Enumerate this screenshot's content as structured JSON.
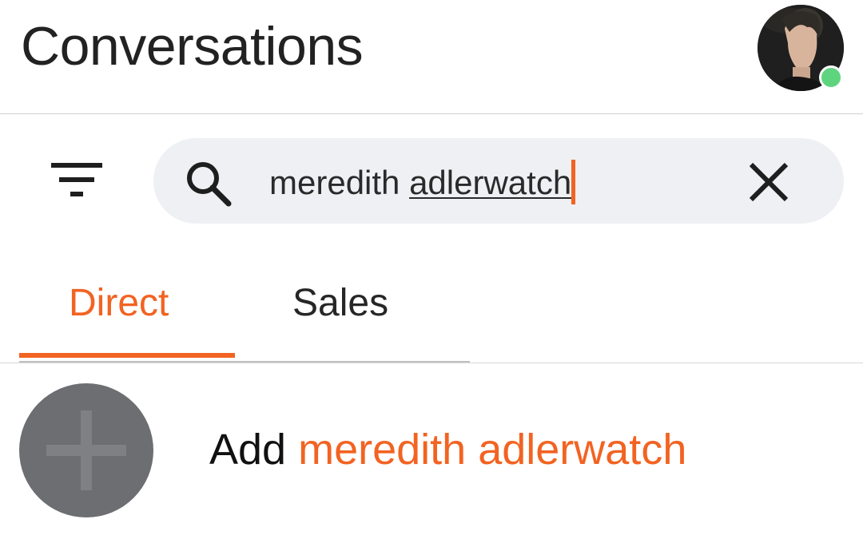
{
  "header": {
    "title": "Conversations",
    "avatar_icon": "profile-photo",
    "presence_status_color": "#5fd47f"
  },
  "search": {
    "filter_icon": "filter-lines-icon",
    "search_icon": "magnifier-icon",
    "clear_icon": "close-x-icon",
    "query_first_word": "meredith",
    "query_second_word": "adlerwatch"
  },
  "tabs": {
    "items": [
      {
        "label": "Direct",
        "active": true
      },
      {
        "label": "Sales",
        "active": false
      }
    ]
  },
  "result": {
    "prefix": "Add",
    "name": "meredith adlerwatch",
    "icon": "plus-icon"
  },
  "colors": {
    "accent": "#f26322",
    "add_avatar_bg": "#6d6e72",
    "add_plus": "#7e8084",
    "search_bg": "#eef0f3"
  }
}
